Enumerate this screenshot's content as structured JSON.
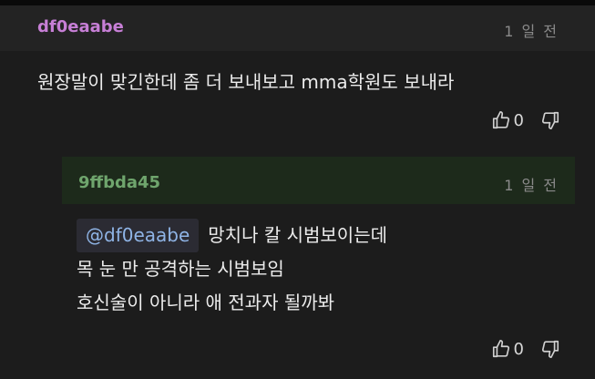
{
  "comment": {
    "author": "df0eaabe",
    "time": "1 일 전",
    "text": "원장말이 맞긴한데 좀 더 보내보고 mma학원도 보내라",
    "likes": "0"
  },
  "reply": {
    "author": "9ffbda45",
    "time": "1 일 전",
    "mention": "@df0eaabe",
    "line1": "망치나 칼 시범보이는데",
    "line2": "목 눈 만 공격하는 시범보임",
    "line3": "호신술이 아니라 애 전과자 될까봐",
    "likes": "0"
  },
  "icons": {
    "like": "thumbs-up-icon",
    "dislike": "thumbs-down-icon"
  },
  "colors": {
    "comment_author": "#c77fd6",
    "reply_author": "#6fa56d",
    "mention": "#8fb4e6",
    "reply_header_bg": "#1d2a1b"
  }
}
